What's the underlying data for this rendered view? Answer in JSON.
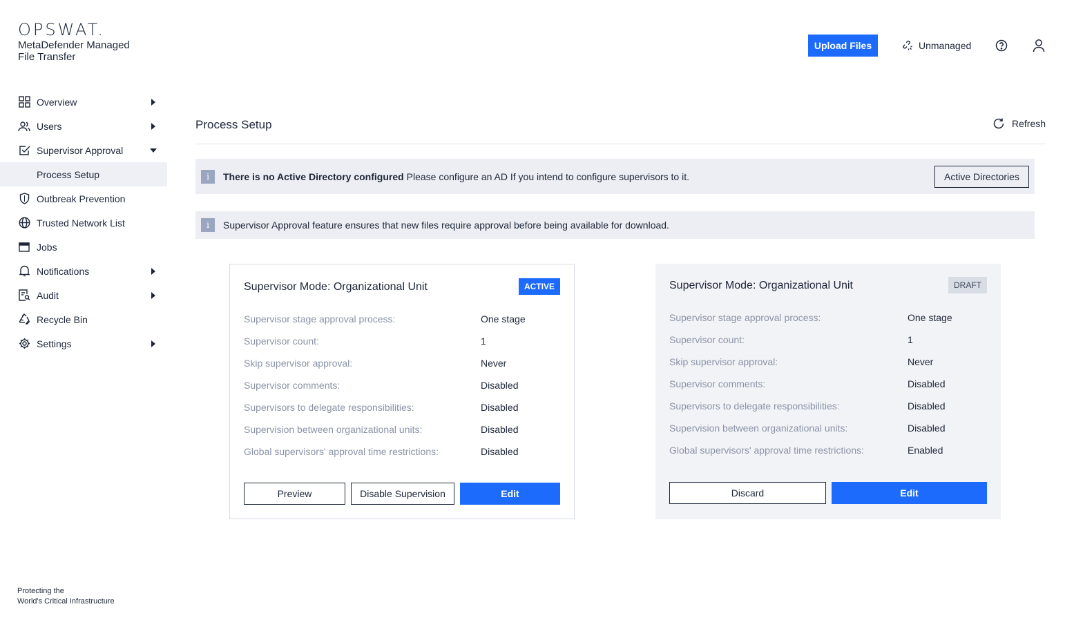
{
  "brand": {
    "logo": "OPSWAT.",
    "product": "MetaDefender Managed File Transfer",
    "tagline_line1": "Protecting the",
    "tagline_line2": "World's Critical Infrastructure"
  },
  "header": {
    "upload_label": "Upload Files",
    "unmanaged_label": "Unmanaged",
    "accent_color": "#1d6bfc"
  },
  "sidebar": {
    "items": [
      {
        "label": "Overview",
        "icon": "grid-icon"
      },
      {
        "label": "Users",
        "icon": "users-icon"
      },
      {
        "label": "Supervisor Approval",
        "icon": "checkbox-icon"
      },
      {
        "label": "Process Setup"
      },
      {
        "label": "Outbreak Prevention",
        "icon": "shield-icon"
      },
      {
        "label": "Trusted Network List",
        "icon": "globe-icon"
      },
      {
        "label": "Jobs",
        "icon": "window-icon"
      },
      {
        "label": "Notifications",
        "icon": "bell-icon"
      },
      {
        "label": "Audit",
        "icon": "audit-icon"
      },
      {
        "label": "Recycle Bin",
        "icon": "recycle-icon"
      },
      {
        "label": "Settings",
        "icon": "gear-icon"
      }
    ]
  },
  "main": {
    "title": "Process Setup",
    "refresh_label": "Refresh",
    "alert_ad": {
      "bold": "There is no Active Directory configured",
      "text": "Please configure an AD If you intend to configure supervisors to it.",
      "button": "Active Directories"
    },
    "alert_info": {
      "text": "Supervisor Approval feature ensures that new files require approval before being available for download."
    },
    "info_glyph": "i"
  },
  "cards": {
    "active": {
      "title": "Supervisor Mode: Organizational Unit",
      "badge": "ACTIVE",
      "rows": [
        {
          "k": "Supervisor stage approval process:",
          "v": "One stage"
        },
        {
          "k": "Supervisor count:",
          "v": "1"
        },
        {
          "k": "Skip supervisor approval:",
          "v": "Never"
        },
        {
          "k": "Supervisor comments:",
          "v": "Disabled"
        },
        {
          "k": "Supervisors to delegate responsibilities:",
          "v": "Disabled"
        },
        {
          "k": "Supervision between organizational units:",
          "v": "Disabled"
        },
        {
          "k": "Global supervisors' approval time restrictions:",
          "v": "Disabled"
        }
      ],
      "preview_label": "Preview",
      "disable_label": "Disable Supervision",
      "edit_label": "Edit"
    },
    "draft": {
      "title": "Supervisor Mode: Organizational Unit",
      "badge": "DRAFT",
      "rows": [
        {
          "k": "Supervisor stage approval process:",
          "v": "One stage"
        },
        {
          "k": "Supervisor count:",
          "v": "1"
        },
        {
          "k": "Skip supervisor approval:",
          "v": "Never"
        },
        {
          "k": "Supervisor comments:",
          "v": "Disabled"
        },
        {
          "k": "Supervisors to delegate responsibilities:",
          "v": "Disabled"
        },
        {
          "k": "Supervision between organizational units:",
          "v": "Disabled"
        },
        {
          "k": "Global supervisors' approval time restrictions:",
          "v": "Enabled"
        }
      ],
      "discard_label": "Discard",
      "edit_label": "Edit"
    }
  }
}
